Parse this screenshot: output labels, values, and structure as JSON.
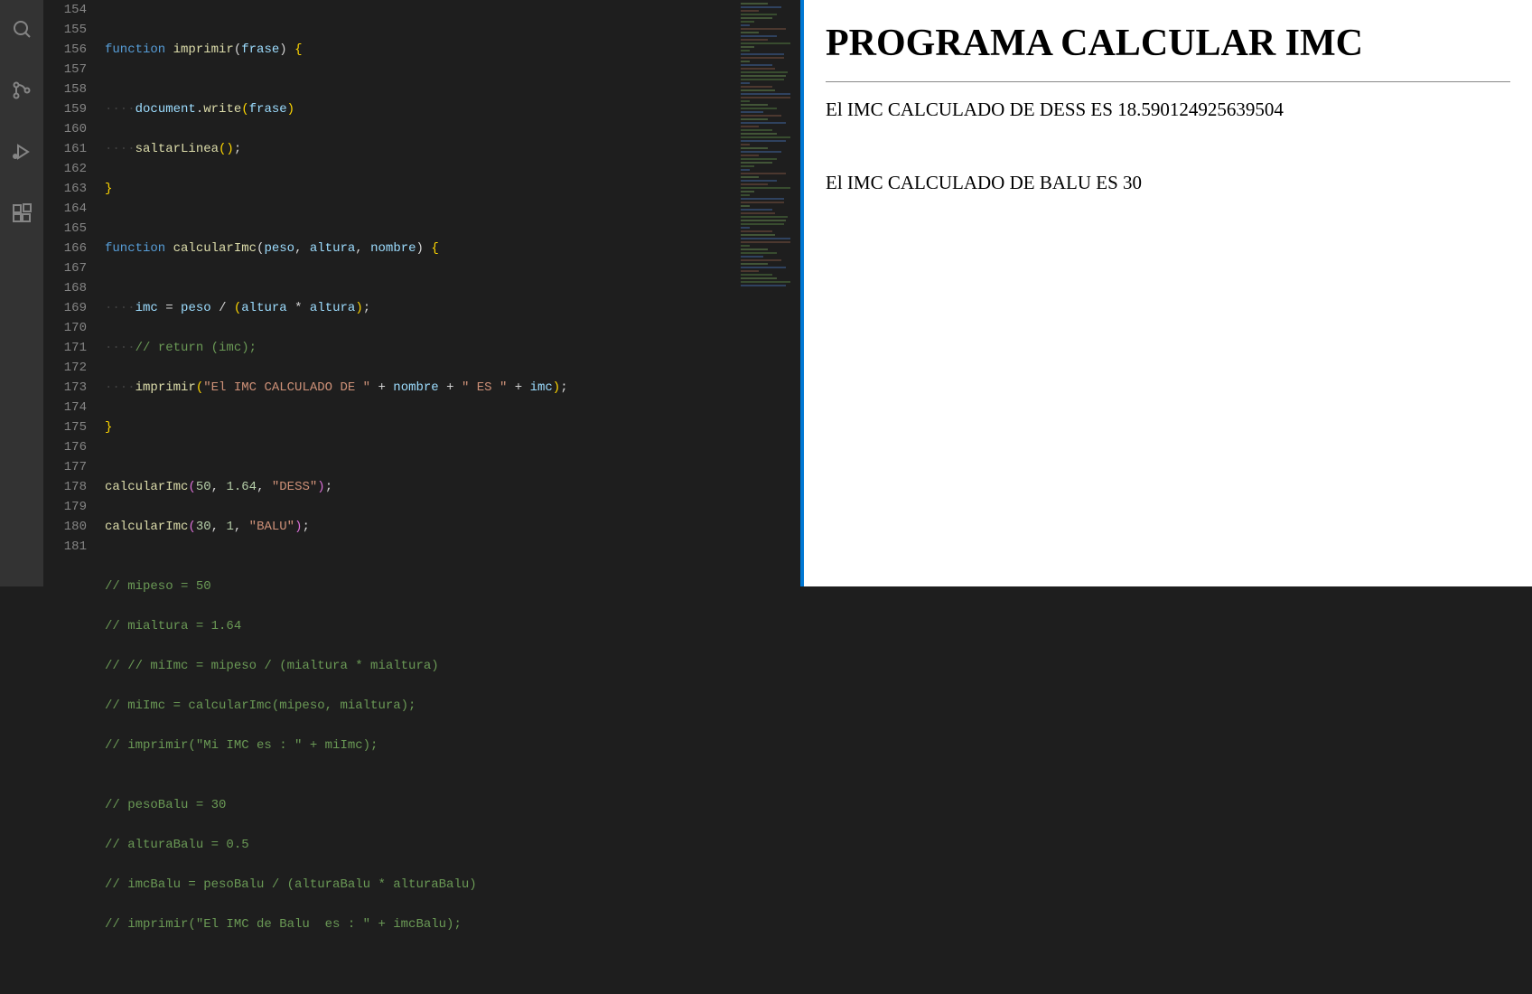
{
  "lineStart": 154,
  "lineEnd": 181,
  "code": {
    "l154": "",
    "l155_kw": "function",
    "l155_fn": "imprimir",
    "l155_p1": "frase",
    "l156": "",
    "l157_obj": "document",
    "l157_m": "write",
    "l157_a": "frase",
    "l158_fn": "saltarLinea",
    "l159": "}",
    "l160": "",
    "l161_kw": "function",
    "l161_fn": "calcularImc",
    "l161_p1": "peso",
    "l161_p2": "altura",
    "l161_p3": "nombre",
    "l162": "",
    "l163_v": "imc",
    "l163_r": "peso / (altura * altura);",
    "l164_c": "// return (imc);",
    "l165_fn": "imprimir",
    "l165_s1": "\"El IMC CALCULADO DE \"",
    "l165_v1": "nombre",
    "l165_s2": "\" ES \"",
    "l165_v2": "imc",
    "l166": "}",
    "l167": "",
    "l168_fn": "calcularImc",
    "l168_n1": "50",
    "l168_n2": "1.64",
    "l168_s": "\"DESS\"",
    "l169_fn": "calcularImc",
    "l169_n1": "30",
    "l169_n2": "1",
    "l169_s": "\"BALU\"",
    "l170": "",
    "l171": "// mipeso = 50",
    "l172": "// mialtura = 1.64",
    "l173": "// // miImc = mipeso / (mialtura * mialtura)",
    "l174": "// miImc = calcularImc(mipeso, mialtura);",
    "l175": "// imprimir(\"Mi IMC es : \" + miImc);",
    "l176": "",
    "l177": "// pesoBalu = 30",
    "l178": "// alturaBalu = 0.5",
    "l179": "// imcBalu = pesoBalu / (alturaBalu * alturaBalu)",
    "l180": "// imprimir(\"El IMC de Balu  es : \" + imcBalu);",
    "l181": ""
  },
  "output": {
    "title": "PROGRAMA CALCULAR IMC",
    "line1": "El IMC CALCULADO DE DESS ES 18.590124925639504",
    "line2": "El IMC CALCULADO DE BALU ES 30"
  }
}
